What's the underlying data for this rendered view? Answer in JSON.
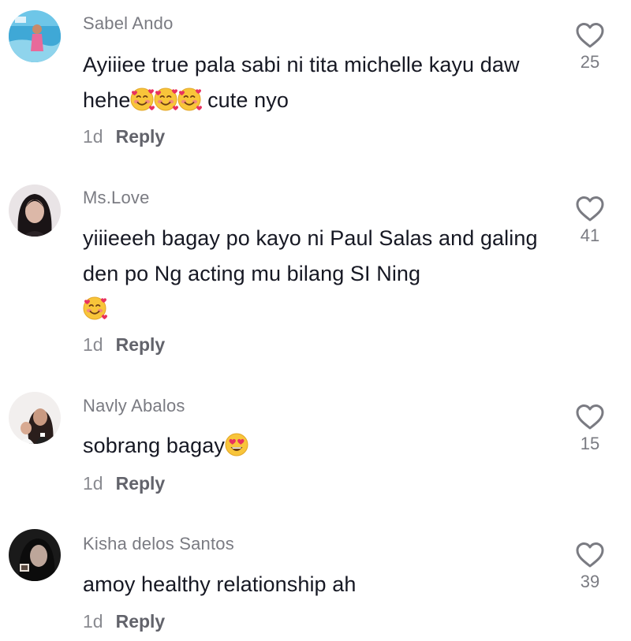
{
  "comments": [
    {
      "username": "Sabel Ando",
      "text_parts": [
        "Ayiiiee true pala sabi ni tita michelle kayu daw hehe",
        " cute nyo"
      ],
      "emojis": [
        "smiling-face-with-hearts",
        "smiling-face-with-hearts",
        "smiling-face-with-hearts"
      ],
      "time": "1d",
      "reply_label": "Reply",
      "likes": "25"
    },
    {
      "username": "Ms.Love",
      "text_parts": [
        "yiiieeeh bagay po kayo ni Paul Salas and galing den po Ng acting mu bilang SI Ning"
      ],
      "emojis": [
        "smiling-face-with-hearts"
      ],
      "time": "1d",
      "reply_label": "Reply",
      "likes": "41"
    },
    {
      "username": "Navly Abalos",
      "text_parts": [
        "sobrang bagay"
      ],
      "emojis": [
        "heart-eyes-face"
      ],
      "time": "1d",
      "reply_label": "Reply",
      "likes": "15"
    },
    {
      "username": "Kisha delos Santos",
      "text_parts": [
        "amoy healthy relationship ah"
      ],
      "emojis": [],
      "time": "1d",
      "reply_label": "Reply",
      "likes": "39"
    }
  ],
  "icons": {
    "like": "heart-outline-icon",
    "emoji_primary": "smiling-face-with-hearts",
    "emoji_secondary": "heart-eyes-face"
  },
  "colors": {
    "username": "#7a7b82",
    "text": "#161823",
    "meta": "#8a8b91",
    "reply": "#62636b",
    "like_icon": "#7a7b82"
  }
}
